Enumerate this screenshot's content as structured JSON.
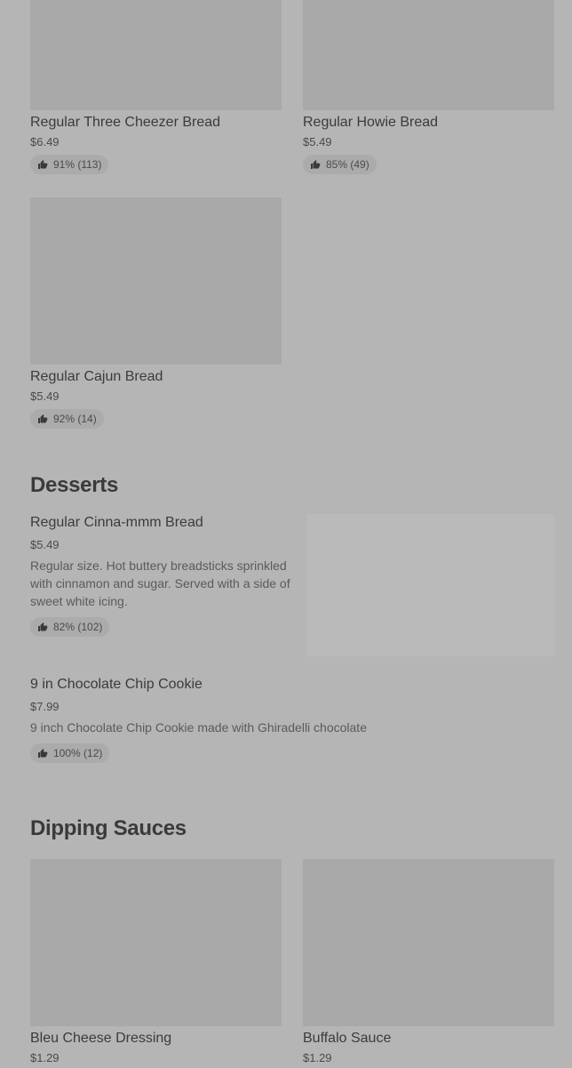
{
  "breads": [
    {
      "name": "Regular Three Cheezer Bread",
      "price": "$6.49",
      "rating": "91% (113)"
    },
    {
      "name": "Regular Howie Bread",
      "price": "$5.49",
      "rating": "85% (49)"
    },
    {
      "name": "Regular Cajun Bread",
      "price": "$5.49",
      "rating": "92% (14)"
    }
  ],
  "desserts": {
    "title": "Desserts",
    "items": [
      {
        "name": "Regular Cinna-mmm Bread",
        "price": "$5.49",
        "description": "Regular size. Hot buttery breadsticks sprinkled with cinnamon and sugar. Served with a side of sweet white icing.",
        "rating": "82% (102)"
      },
      {
        "name": "9 in Chocolate Chip Cookie",
        "price": "$7.99",
        "description": "9 inch Chocolate Chip Cookie made with Ghiradelli chocolate",
        "rating": "100% (12)"
      }
    ]
  },
  "sauces": {
    "title": "Dipping Sauces",
    "items": [
      {
        "name": "Bleu Cheese Dressing",
        "price": "$1.29"
      },
      {
        "name": "Buffalo Sauce",
        "price": "$1.29"
      }
    ]
  },
  "icons": {
    "rating": "thumbs-up-icon"
  }
}
